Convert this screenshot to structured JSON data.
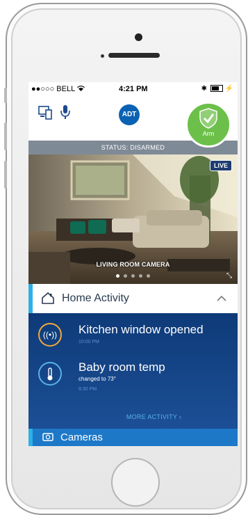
{
  "statusbar": {
    "carrier": "●●○○○ BELL",
    "time": "4:21 PM",
    "right_icons": "✱"
  },
  "appbar": {
    "logo_text": "ADT",
    "arm_label": "Arm"
  },
  "status_strip": "STATUS: DISARMED",
  "camera": {
    "live_badge": "LIVE",
    "label": "LIVING ROOM CAMERA",
    "dot_count": 5,
    "active_dot": 0
  },
  "home_activity": {
    "title": "Home Activity",
    "items": [
      {
        "title": "Kitchen window opened",
        "subtitle": "",
        "time": "10:00 PM",
        "icon": "sensor-icon",
        "ring_color": "#f2a93b"
      },
      {
        "title": "Baby room temp",
        "subtitle": "changed to 73°",
        "time": "9:30 PM",
        "icon": "thermometer-icon",
        "ring_color": "#58b3e8"
      }
    ],
    "more_label": "MORE ACTIVITY  ›"
  },
  "cameras_section": {
    "title": "Cameras"
  },
  "colors": {
    "accent": "#2bb1e5",
    "activity_bg": "#0e3a78",
    "arm_green": "#6cc04a",
    "adt_blue": "#0b62b4"
  }
}
